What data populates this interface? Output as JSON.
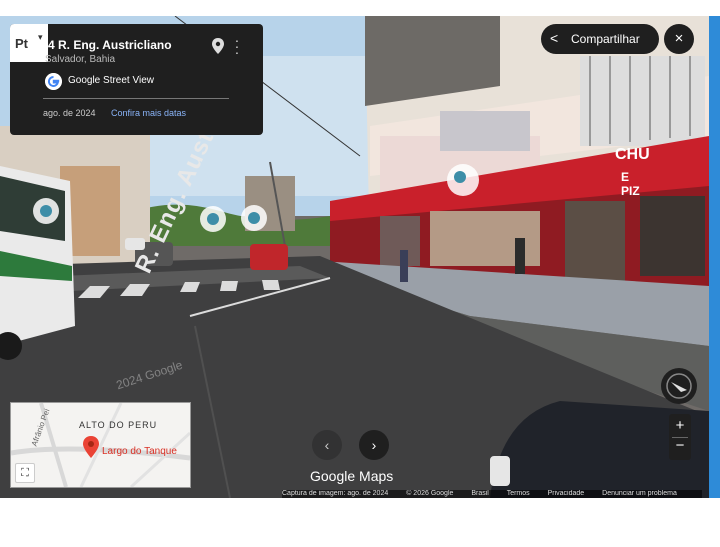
{
  "info_card": {
    "lang_button": "Pt",
    "title": "4 R. Eng. Austricliano",
    "subtitle": "Salvador, Bahia",
    "brand": "Google Street View",
    "capture_date": "ago. de 2024",
    "more_dates_link": "Confira mais datas"
  },
  "toolbar": {
    "share_label": "Compartilhar",
    "close_icon": "×",
    "share_icon": "<"
  },
  "scene": {
    "road_marking": "R. Eng. Austric",
    "watermark": "2024 Google",
    "shop_sign": "CHU\nE PIZ"
  },
  "minimap": {
    "area_label": "ALTO DO PERU",
    "street_label": "Afrânio Pei",
    "place_label": "Largo do Tanque",
    "expand_icon": "⛶"
  },
  "navigation": {
    "back_icon": "‹",
    "forward_icon": "›",
    "brand_label": "Google Maps"
  },
  "zoom": {
    "in_label": "+",
    "out_label": "−"
  },
  "footer": [
    "Captura de imagem: ago. de 2024",
    "© 2026 Google",
    "Brasil",
    "Termos",
    "Privacidade",
    "Denunciar um problema"
  ],
  "colors": {
    "panel": "#1f1f1f",
    "link": "#8ab4f8",
    "accent_strip": "#2e8bd8",
    "storefront": "#c9202b"
  }
}
